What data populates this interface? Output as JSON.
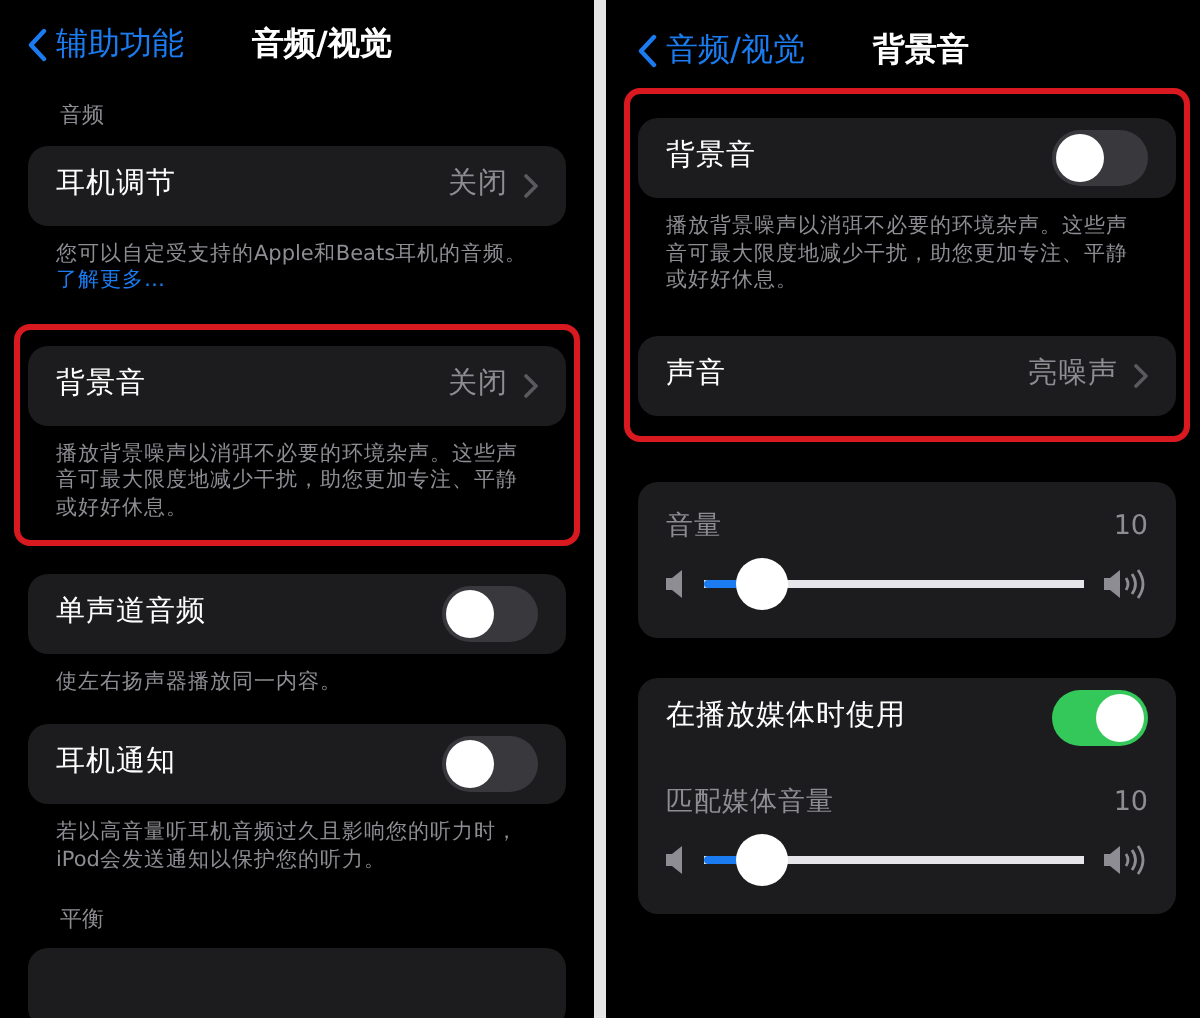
{
  "panels": [
    {
      "nav": {
        "back": "辅助功能",
        "title": "音频/视觉"
      },
      "blocks": [
        {
          "kind": "group",
          "header": "音频",
          "rows": [
            {
              "kind": "value",
              "label": "耳机调节",
              "value": "关闭"
            }
          ],
          "footer": {
            "text": "您可以自定受支持的Apple和Beats耳机的音频。",
            "link": "了解更多…"
          }
        },
        {
          "kind": "highlight",
          "groups": [
            {
              "rows": [
                {
                  "kind": "value",
                  "label": "背景音",
                  "value": "关闭"
                }
              ],
              "footer": {
                "text": "播放背景噪声以消弭不必要的环境杂声。这些声音可最大限度地减少干扰，助您更加专注、平静或好好休息。"
              }
            }
          ]
        },
        {
          "kind": "group",
          "rows": [
            {
              "kind": "toggle",
              "label": "单声道音频",
              "on": false
            }
          ],
          "footer": {
            "text": "使左右扬声器播放同一内容。"
          }
        },
        {
          "kind": "group",
          "rows": [
            {
              "kind": "toggle",
              "label": "耳机通知",
              "on": false
            }
          ],
          "footer": {
            "text": "若以高音量听耳机音频过久且影响您的听力时，iPod会发送通知以保护您的听力。"
          }
        },
        {
          "kind": "group",
          "header": "平衡"
        }
      ]
    },
    {
      "nav": {
        "back": "音频/视觉",
        "title": "背景音"
      },
      "blocks": [
        {
          "kind": "highlight",
          "groups": [
            {
              "rows": [
                {
                  "kind": "toggle",
                  "label": "背景音",
                  "on": false
                }
              ],
              "footer": {
                "text": "播放背景噪声以消弭不必要的环境杂声。这些声音可最大限度地减少干扰，助您更加专注、平静或好好休息。"
              }
            },
            {
              "rows": [
                {
                  "kind": "value",
                  "label": "声音",
                  "value": "亮噪声"
                }
              ]
            }
          ]
        },
        {
          "kind": "group",
          "rows": [
            {
              "kind": "slider",
              "label": "音量",
              "reading": "10",
              "level": 0.15
            }
          ]
        },
        {
          "kind": "group",
          "rows": [
            {
              "kind": "toggle",
              "label": "在播放媒体时使用",
              "on": true
            },
            {
              "kind": "slider",
              "label": "匹配媒体音量",
              "reading": "10",
              "level": 0.15
            }
          ]
        }
      ]
    }
  ]
}
